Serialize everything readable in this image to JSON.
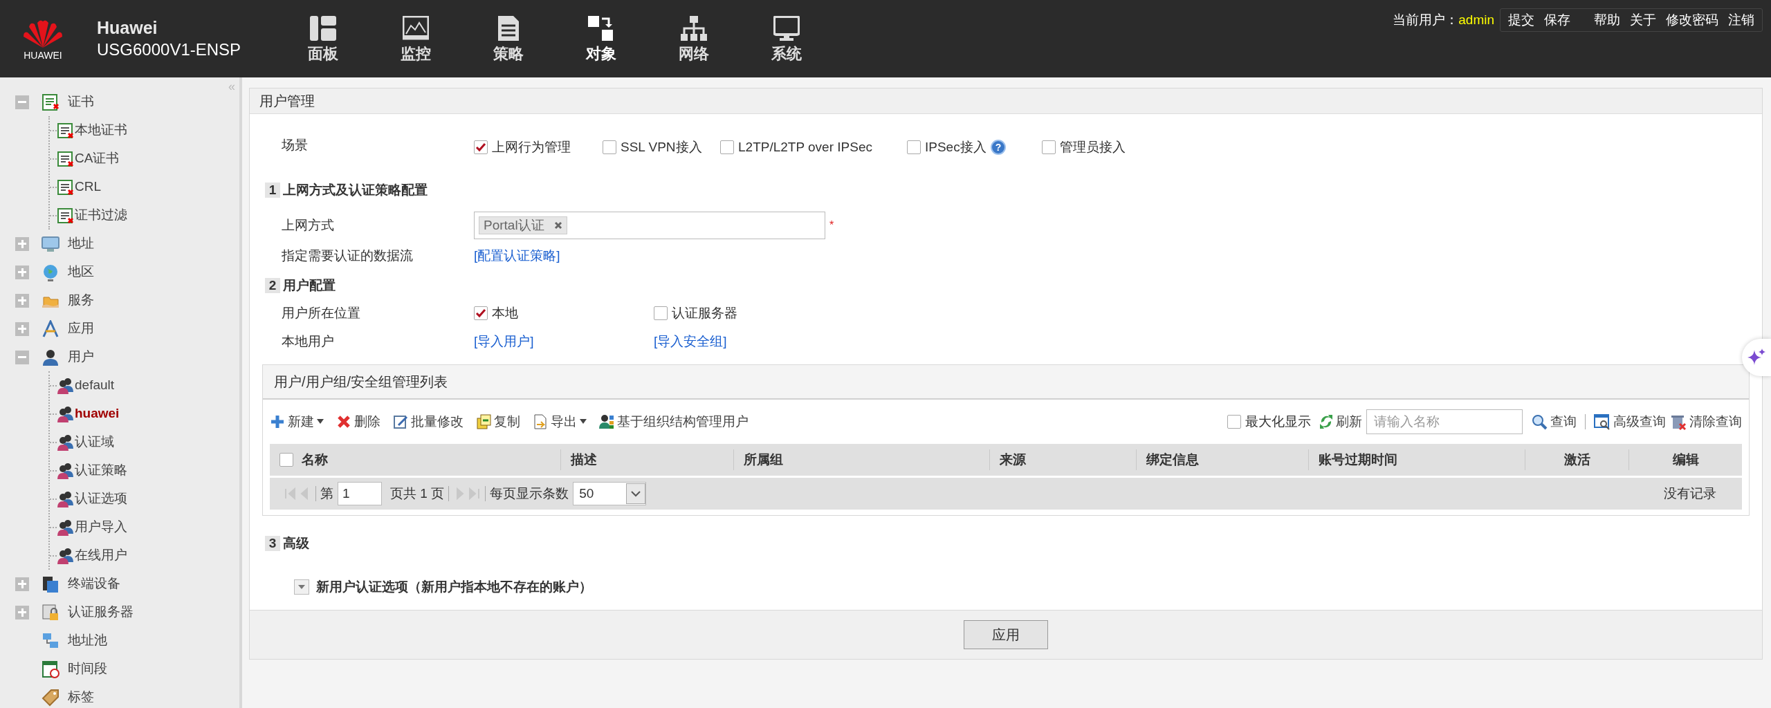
{
  "header": {
    "logo_text": "HUAWEI",
    "brand": "Huawei",
    "model": "USG6000V1-ENSP",
    "nav": [
      {
        "label": "面板",
        "selected": false
      },
      {
        "label": "监控",
        "selected": false
      },
      {
        "label": "策略",
        "selected": false
      },
      {
        "label": "对象",
        "selected": true
      },
      {
        "label": "网络",
        "selected": false
      },
      {
        "label": "系统",
        "selected": false
      }
    ],
    "user_label": "当前用户：",
    "user": "admin",
    "actions": [
      "提交",
      "保存",
      "帮助",
      "关于",
      "修改密码",
      "注销"
    ]
  },
  "sidebar": {
    "collapse_glyph": "«",
    "items": [
      {
        "label": "证书",
        "expanded": true,
        "children": [
          {
            "label": "本地证书",
            "selected": false
          },
          {
            "label": "CA证书",
            "selected": false
          },
          {
            "label": "CRL",
            "selected": false
          },
          {
            "label": "证书过滤",
            "selected": false
          }
        ]
      },
      {
        "label": "地址",
        "expanded": false
      },
      {
        "label": "地区",
        "expanded": false
      },
      {
        "label": "服务",
        "expanded": false
      },
      {
        "label": "应用",
        "expanded": false
      },
      {
        "label": "用户",
        "expanded": true,
        "children": [
          {
            "label": "default",
            "selected": false
          },
          {
            "label": "huawei",
            "selected": true
          },
          {
            "label": "认证域",
            "selected": false
          },
          {
            "label": "认证策略",
            "selected": false
          },
          {
            "label": "认证选项",
            "selected": false
          },
          {
            "label": "用户导入",
            "selected": false
          },
          {
            "label": "在线用户",
            "selected": false
          }
        ]
      },
      {
        "label": "终端设备",
        "expanded": false
      },
      {
        "label": "认证服务器",
        "expanded": false
      },
      {
        "label": "地址池"
      },
      {
        "label": "时间段"
      },
      {
        "label": "标签"
      }
    ]
  },
  "panel": {
    "title": "用户管理",
    "scene": {
      "label": "场景",
      "help_glyph": "?",
      "options": [
        {
          "label": "上网行为管理",
          "checked": true,
          "help": false
        },
        {
          "label": "SSL VPN接入",
          "checked": false,
          "help": false
        },
        {
          "label": "L2TP/L2TP over IPSec",
          "checked": false,
          "help": false
        },
        {
          "label": "IPSec接入",
          "checked": false,
          "help": true
        },
        {
          "label": "管理员接入",
          "checked": false,
          "help": false
        }
      ]
    },
    "section1": {
      "number": "1",
      "title": "上网方式及认证策略配置",
      "access_label": "上网方式",
      "access_tag": "Portal认证",
      "required": "*",
      "flow_label": "指定需要认证的数据流",
      "flow_link": "[配置认证策略]"
    },
    "section2": {
      "number": "2",
      "title": "用户配置",
      "location_label": "用户所在位置",
      "locations": [
        {
          "label": "本地",
          "checked": true
        },
        {
          "label": "认证服务器",
          "checked": false
        }
      ],
      "local_label": "本地用户",
      "links": [
        "[导入用户]",
        "[导入安全组]"
      ]
    },
    "table": {
      "title": "用户/用户组/安全组管理列表",
      "toolbar": [
        {
          "label": "新建",
          "menu": true
        },
        {
          "label": "删除",
          "menu": false
        },
        {
          "label": "批量修改",
          "menu": false
        },
        {
          "label": "复制",
          "menu": false
        },
        {
          "label": "导出",
          "menu": true
        },
        {
          "label": "基于组织结构管理用户",
          "menu": false
        }
      ],
      "maximize": {
        "label": "最大化显示",
        "checked": false
      },
      "refresh": "刷新",
      "search_placeholder": "请输入名称",
      "query": "查询",
      "advanced_query": "高级查询",
      "clear_query": "清除查询",
      "select_all_checked": false,
      "columns": [
        "名称",
        "描述",
        "所属组",
        "来源",
        "绑定信息",
        "账号过期时间",
        "激活",
        "编辑"
      ],
      "pager": {
        "page_prefix": "第",
        "page": "1",
        "page_suffix": "页共 1 页",
        "per_page_label": "每页显示条数",
        "per_page": "50",
        "empty": "没有记录"
      }
    },
    "section3": {
      "number": "3",
      "title": "高级",
      "expander": "新用户认证选项（新用户指本地不存在的账户）"
    }
  },
  "apply": "应用"
}
